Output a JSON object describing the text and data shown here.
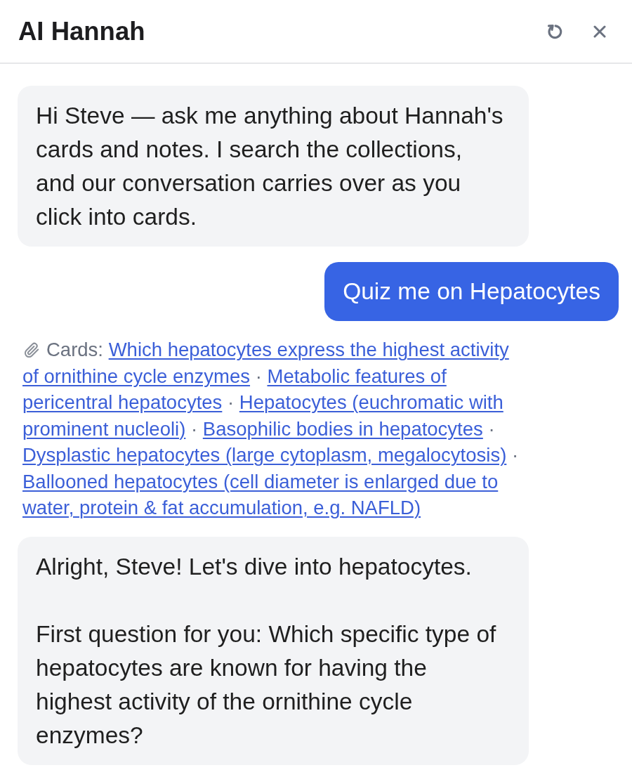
{
  "header": {
    "title": "AI Hannah"
  },
  "messages": [
    {
      "kind": "assistant",
      "paragraphs": [
        "Hi Steve — ask me anything about Hannah's cards and notes. I search the collections, and our conversation carries over as you click into cards."
      ]
    },
    {
      "kind": "user",
      "text": "Quiz me on Hepatocytes"
    },
    {
      "kind": "sources",
      "label": "Cards:",
      "separator": "·",
      "links": [
        "Which hepatocytes express the highest activity of ornithine cycle enzymes",
        "Metabolic features of pericentral hepatocytes",
        "Hepatocytes (euchromatic with prominent nucleoli)",
        "Basophilic bodies in hepatocytes",
        "Dysplastic hepatocytes (large cytoplasm, megalocytosis)",
        "Ballooned hepatocytes (cell diameter is enlarged due to water, protein & fat accumulation, e.g. NAFLD)"
      ]
    },
    {
      "kind": "assistant",
      "paragraphs": [
        "Alright, Steve! Let's dive into hepatocytes.",
        "First question for you: Which specific type of hepatocytes are known for having the highest activity of the ornithine cycle enzymes?"
      ]
    }
  ]
}
